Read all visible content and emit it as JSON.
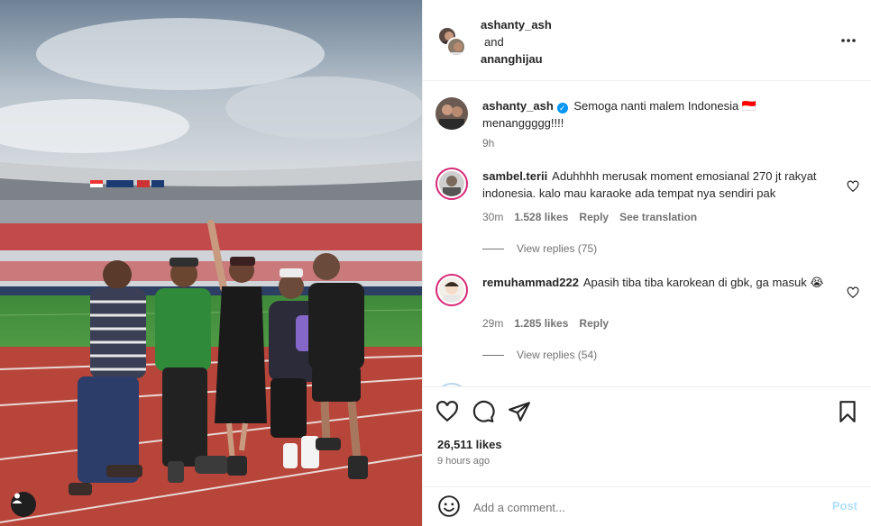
{
  "header": {
    "user1": "ashanty_ash",
    "and_text": "and",
    "user2": "ananghijau"
  },
  "caption": {
    "user": "ashanty_ash",
    "text": "Semoga nanti malem Indonesia 🇮🇩 menanggggg!!!!",
    "time": "9h"
  },
  "comments": [
    {
      "user": "sambel.terii",
      "text": "Aduhhhh merusak moment emosianal 270 jt rakyat indonesia. kalo mau karaoke ada tempat nya sendiri pak",
      "time": "30m",
      "likes": "1.528 likes",
      "reply": "Reply",
      "translate": "See translation",
      "view_replies": "View replies (75)"
    },
    {
      "user": "remuhammad222",
      "text": "Apasih tiba tiba karokean di gbk, ga masuk 😭",
      "time": "29m",
      "likes": "1.285 likes",
      "reply": "Reply",
      "view_replies": "View replies (54)"
    }
  ],
  "post": {
    "likes": "26,511 likes",
    "time": "9 hours ago"
  },
  "add_comment": {
    "placeholder": "Add a comment...",
    "post_label": "Post"
  },
  "icons": {
    "like": "heart-icon",
    "comment": "comment-icon",
    "share": "share-icon",
    "save": "bookmark-icon",
    "more": "more-options-icon",
    "emoji": "emoji-icon",
    "tag": "user-tag-icon"
  },
  "colors": {
    "verified": "#0095f6",
    "post_disabled": "#b2dffc",
    "story_ring": "#d62976",
    "track": "#b8453a",
    "pitch": "#3f8a3a"
  }
}
